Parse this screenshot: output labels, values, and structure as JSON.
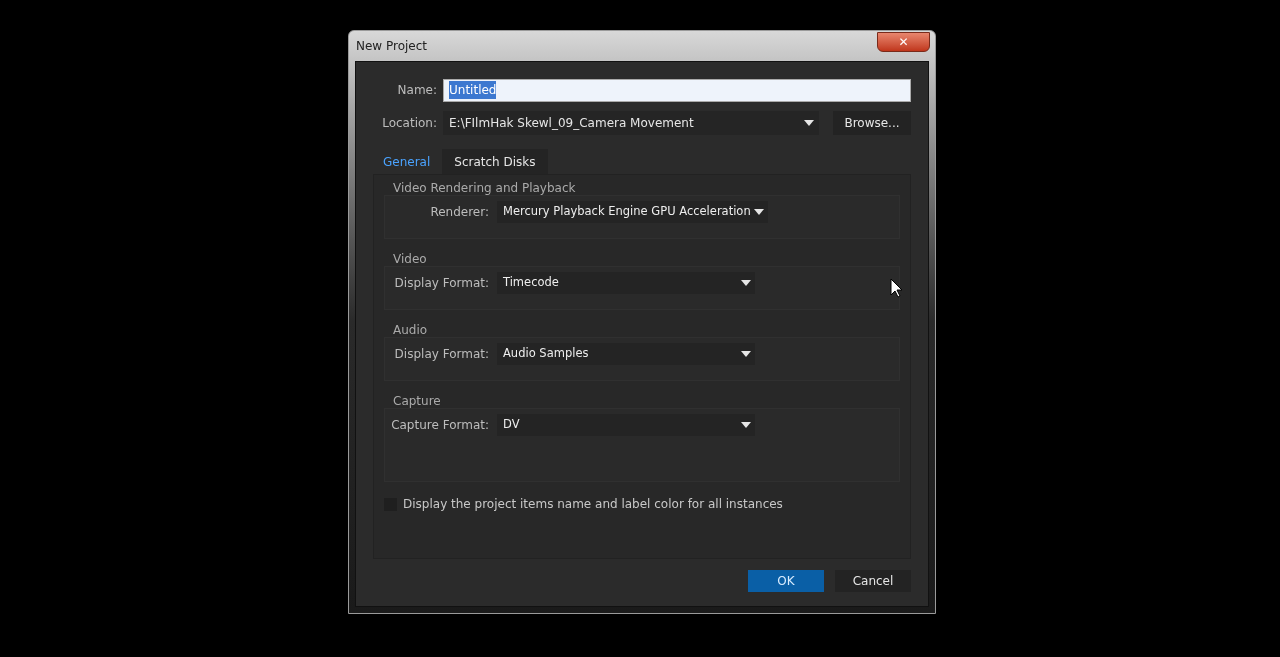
{
  "window": {
    "title": "New Project",
    "close": "✕"
  },
  "name_field": {
    "label": "Name:",
    "value": "Untitled",
    "selected": true
  },
  "location": {
    "label": "Location:",
    "value": "E:\\FIlmHak Skewl_09_Camera Movement",
    "button": "Browse..."
  },
  "tabs": [
    {
      "label": "General",
      "selected": true
    },
    {
      "label": "Scratch Disks",
      "selected": false
    }
  ],
  "sections": [
    {
      "title": "Video Rendering and Playback",
      "label": "Renderer:",
      "value": "Mercury Playback Engine GPU Acceleration",
      "tall": false
    },
    {
      "title": "Video",
      "label": "Display Format:",
      "value": "Timecode",
      "tall": false
    },
    {
      "title": "Audio",
      "label": "Display Format:",
      "value": "Audio Samples",
      "tall": false
    },
    {
      "title": "Capture",
      "label": "Capture Format:",
      "value": "DV",
      "tall": true
    }
  ],
  "checkbox": {
    "label": "Display the project items name and label color for all instances",
    "checked": false
  },
  "buttons": [
    {
      "label": "OK",
      "kind": "primary"
    },
    {
      "label": "Cancel",
      "kind": "secondary"
    }
  ]
}
